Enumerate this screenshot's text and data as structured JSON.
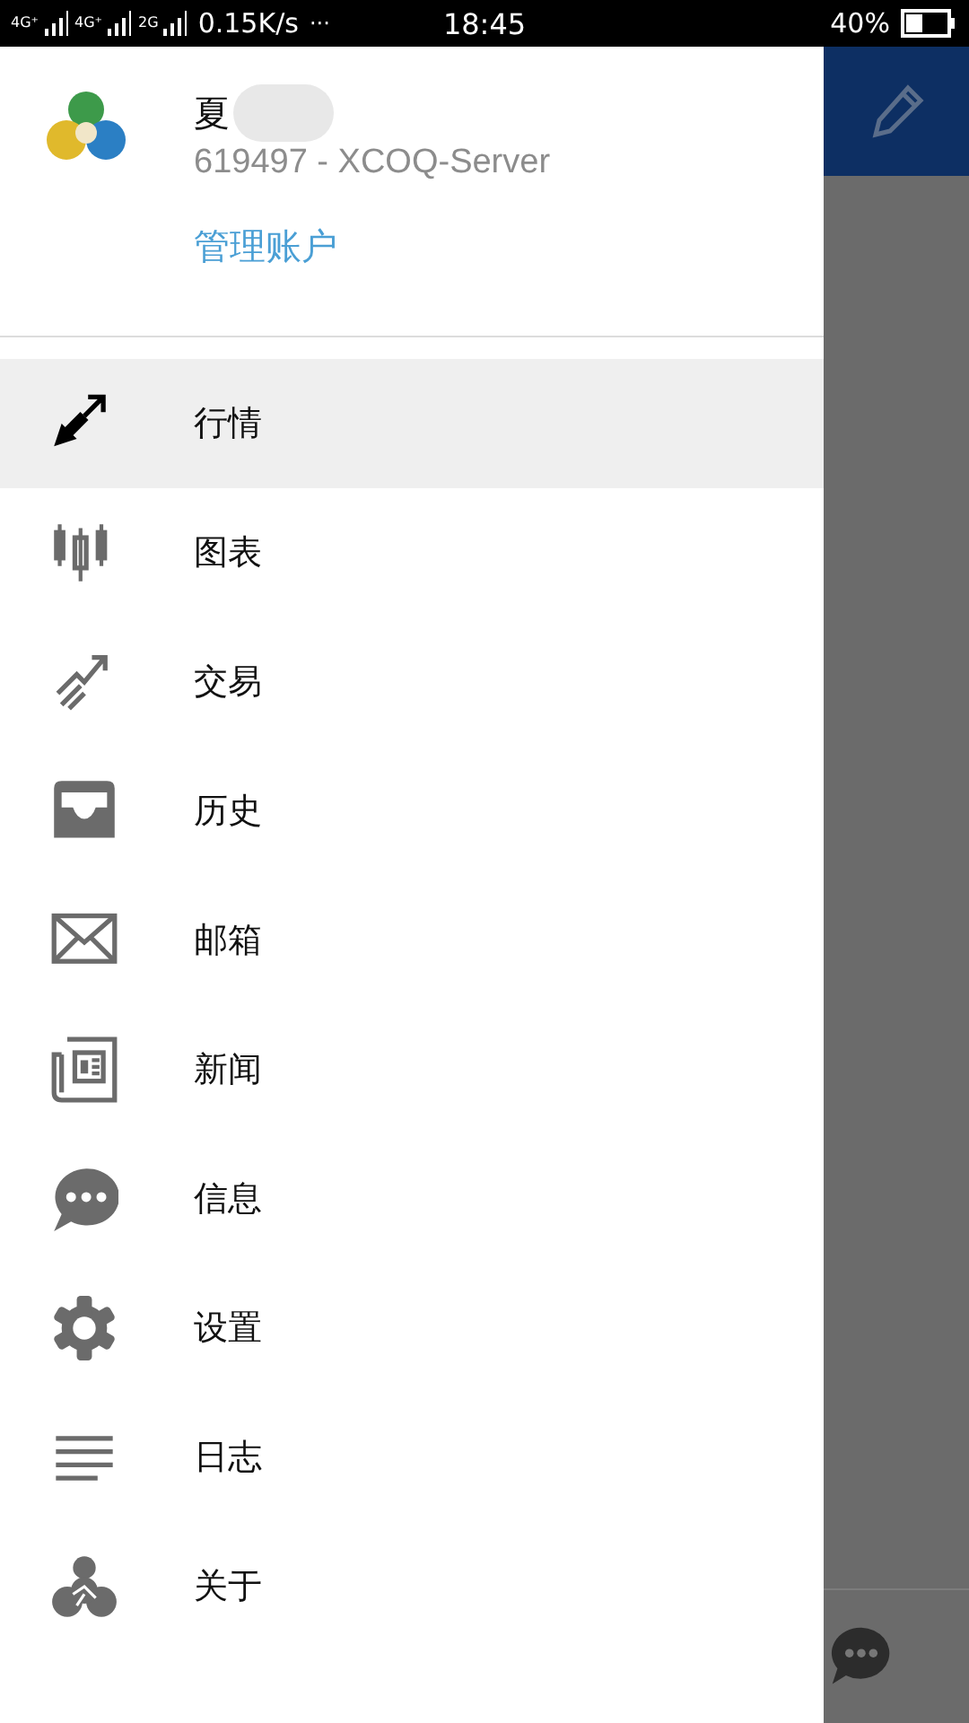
{
  "status_bar": {
    "network_labels": [
      "4G⁺",
      "4G⁺",
      "2G"
    ],
    "speed": "0.15K/s",
    "more": "···",
    "time": "18:45",
    "battery_text": "40%"
  },
  "account": {
    "name": "夏",
    "name_hidden": true,
    "number": "619497 - XCOQ-Server",
    "manage_link": "管理账户"
  },
  "menu": [
    {
      "label": "行情",
      "selected": true
    },
    {
      "label": "图表",
      "selected": false
    },
    {
      "label": "交易",
      "selected": false
    },
    {
      "label": "历史",
      "selected": false
    },
    {
      "label": "邮箱",
      "selected": false
    },
    {
      "label": "新闻",
      "selected": false
    },
    {
      "label": "信息",
      "selected": false
    },
    {
      "label": "设置",
      "selected": false
    },
    {
      "label": "日志",
      "selected": false
    },
    {
      "label": "关于",
      "selected": false
    }
  ]
}
